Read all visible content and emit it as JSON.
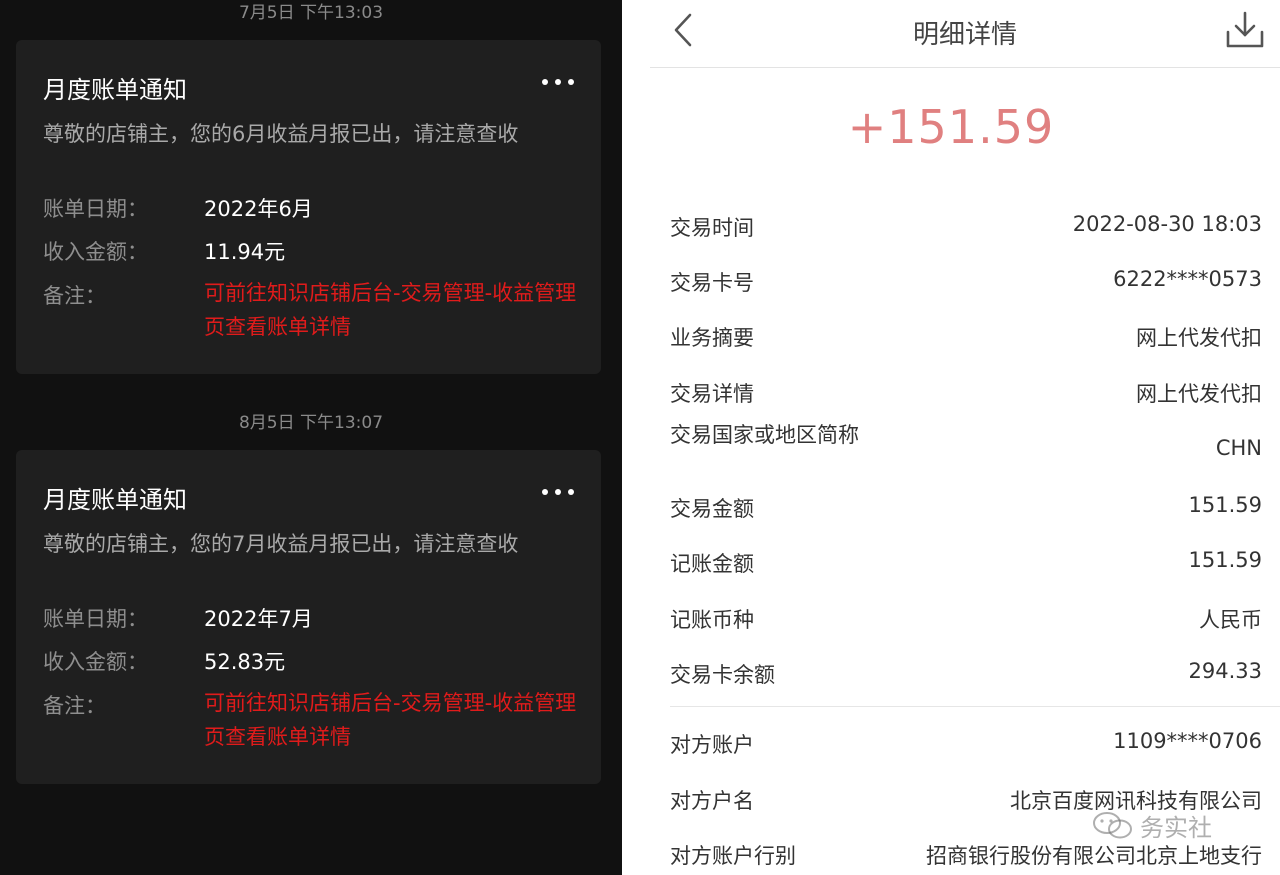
{
  "left": {
    "notifications": [
      {
        "timestamp": "7月5日 下午13:03",
        "title": "月度账单通知",
        "description": "尊敬的店铺主，您的6月收益月报已出，请注意查收",
        "date_label": "账单日期：",
        "date_value": "2022年6月",
        "income_label": "收入金额：",
        "income_value": "11.94元",
        "remark_label": "备注：",
        "remark_value": "可前往知识店铺后台-交易管理-收益管理页查看账单详情"
      },
      {
        "timestamp": "8月5日 下午13:07",
        "title": "月度账单通知",
        "description": "尊敬的店铺主，您的7月收益月报已出，请注意查收",
        "date_label": "账单日期：",
        "date_value": "2022年7月",
        "income_label": "收入金额：",
        "income_value": "52.83元",
        "remark_label": "备注：",
        "remark_value": "可前往知识店铺后台-交易管理-收益管理页查看账单详情"
      }
    ]
  },
  "right": {
    "header": {
      "title": "明细详情",
      "back_icon": "chevron-left-icon",
      "download_icon": "download-icon"
    },
    "amount": "+151.59",
    "amount_color": "#e08080",
    "details": [
      {
        "label": "交易时间",
        "value": "2022-08-30 18:03"
      },
      {
        "label": "交易卡号",
        "value": "6222****0573"
      },
      {
        "label": "业务摘要",
        "value": "网上代发代扣"
      },
      {
        "label": "交易详情",
        "value": "网上代发代扣"
      },
      {
        "label": "交易国家或地区简称",
        "value": "CHN"
      },
      {
        "label": "交易金额",
        "value": "151.59"
      },
      {
        "label": "记账金额",
        "value": "151.59"
      },
      {
        "label": "记账币种",
        "value": "人民币"
      },
      {
        "label": "交易卡余额",
        "value": "294.33"
      }
    ],
    "counterparty": [
      {
        "label": "对方账户",
        "value": "1109****0706"
      },
      {
        "label": "对方户名",
        "value": "北京百度网讯科技有限公司"
      },
      {
        "label": "对方账户行别",
        "value": "招商银行股份有限公司北京上地支行"
      }
    ],
    "watermark": {
      "text": "务实社",
      "icon": "wechat-icon"
    }
  }
}
